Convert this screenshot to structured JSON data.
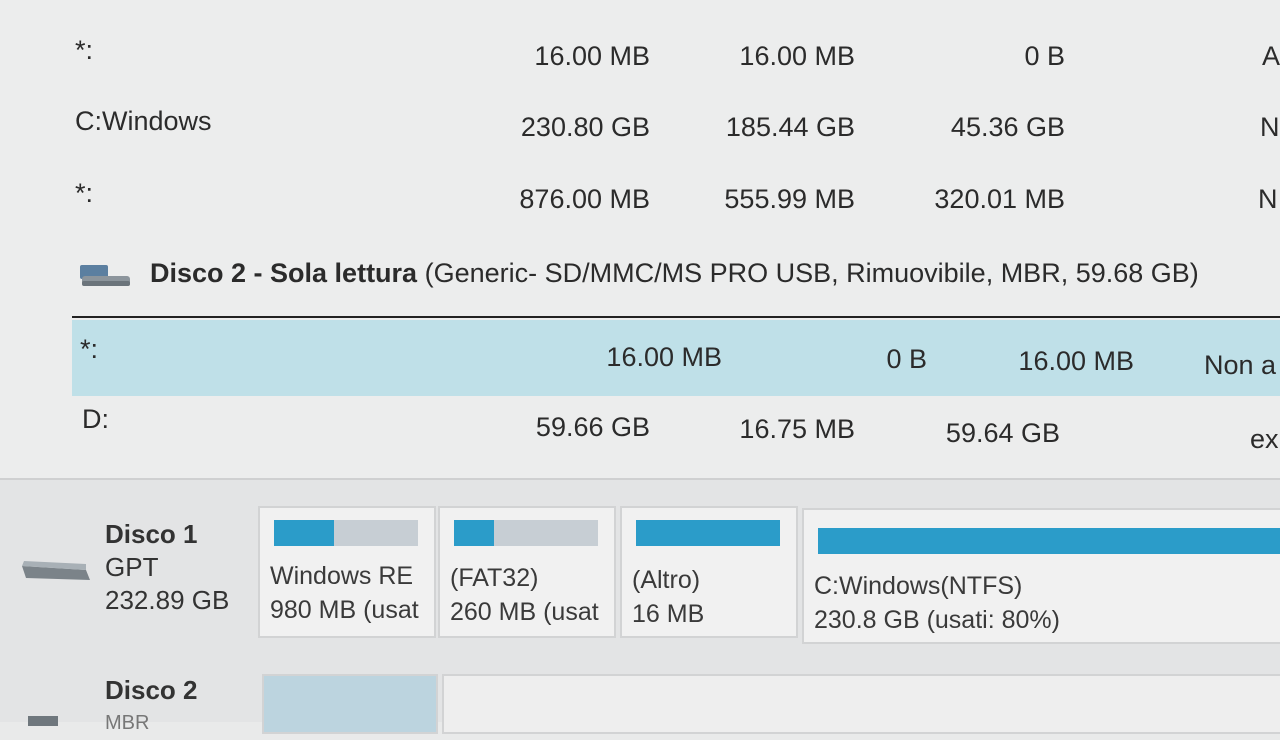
{
  "volumes_disk1": [
    {
      "name": "*:",
      "capacity": "16.00 MB",
      "used": "16.00 MB",
      "free": "0 B",
      "extra": "A"
    },
    {
      "name": "C:Windows",
      "capacity": "230.80 GB",
      "used": "185.44 GB",
      "free": "45.36 GB",
      "extra": "N"
    },
    {
      "name": "*:",
      "capacity": "876.00 MB",
      "used": "555.99 MB",
      "free": "320.01 MB",
      "extra": "N"
    }
  ],
  "disk2_header": {
    "title": "Disco 2 - Sola lettura",
    "details": "(Generic- SD/MMC/MS PRO USB, Rimuovibile, MBR, 59.68 GB)"
  },
  "volumes_disk2": [
    {
      "name": "*:",
      "capacity": "16.00 MB",
      "used": "0 B",
      "free": "16.00 MB",
      "extra": "Non a",
      "selected": true
    },
    {
      "name": "D:",
      "capacity": "59.66 GB",
      "used": "16.75 MB",
      "free": "59.64 GB",
      "extra": "ex"
    }
  ],
  "disk_map": {
    "disk1": {
      "name": "Disco 1",
      "type": "GPT",
      "size": "232.89 GB"
    },
    "partitions": [
      {
        "label": "Windows RE",
        "size": "980 MB (usat",
        "used_fraction": 0.42
      },
      {
        "label": "(FAT32)",
        "size": "260 MB (usat",
        "used_fraction": 0.28
      },
      {
        "label": "(Altro)",
        "size": "16 MB",
        "used_fraction": 1.0
      },
      {
        "label": "C:Windows(NTFS)",
        "size": "230.8 GB (usati: 80%)",
        "used_fraction": 1.0
      }
    ],
    "disk2": {
      "name": "Disco 2",
      "type": "MBR"
    }
  },
  "colors": {
    "accent": "#2b9cc9",
    "selected_row": "#bfe0e8"
  }
}
